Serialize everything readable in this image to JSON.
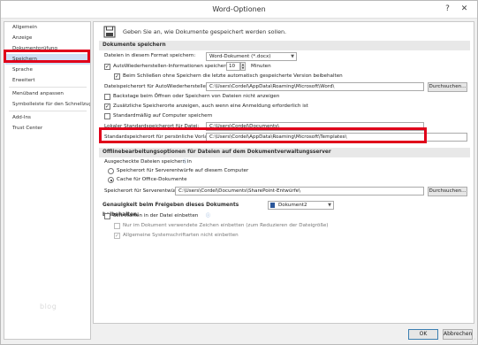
{
  "window": {
    "title": "Word-Optionen",
    "help": "?",
    "close": "✕"
  },
  "sidebar": {
    "items": [
      {
        "label": "Allgemein"
      },
      {
        "label": "Anzeige"
      },
      {
        "label": "Dokumentprüfung"
      },
      {
        "label": "Speichern",
        "selected": true
      },
      {
        "label": "Sprache"
      },
      {
        "label": "Erweitert"
      },
      {
        "label": "Menüband anpassen"
      },
      {
        "label": "Symbolleiste für den Schnellzugriff"
      },
      {
        "label": "Add-Ins"
      },
      {
        "label": "Trust Center"
      }
    ],
    "watermark": "blog"
  },
  "content": {
    "header": "Geben Sie an, wie Dokumente gespeichert werden sollen.",
    "save_section": {
      "title": "Dokumente speichern",
      "format_label": "Dateien in diesem Format speichern:",
      "format_value": "Word-Dokument (*.docx)",
      "autorecover_label": "AutoWiederherstellen-Informationen speichern alle",
      "autorecover_minutes": "10",
      "minutes_label": "Minuten",
      "keep_last_label": "Beim Schließen ohne Speichern die letzte automatisch gespeicherte Version beibehalten",
      "autorecover_path_label": "Dateispeicherort für AutoWiederherstellen:",
      "autorecover_path": "C:\\Users\\Cordel\\AppData\\Roaming\\Microsoft\\Word\\",
      "browse_label": "Durchsuchen...",
      "backstage_label": "Backstage beim Öffnen oder Speichern von Dateien nicht anzeigen",
      "extra_places_label": "Zusätzliche Speicherorte anzeigen, auch wenn eine Anmeldung erforderlich ist",
      "default_computer_label": "Standardmäßig auf Computer speichern",
      "local_default_label": "Lokaler Standardspeicherort für Datei:",
      "local_default_path": "C:\\Users\\Cordel\\Documents\\",
      "templates_label": "Standardspeicherort für persönliche Vorlagen:",
      "templates_path": "C:\\Users\\Cordel\\AppData\\Roaming\\Microsoft\\Templates\\"
    },
    "offline_section": {
      "title": "Offlinebearbeitungsoptionen für Dateien auf dem Dokumentverwaltungsserver",
      "checked_out_label": "Ausgecheckte Dateien speichern in",
      "option_server_drafts": "Speicherort für Serverentwürfe auf diesem Computer",
      "option_office_cache": "Cache für Office-Dokumente",
      "server_drafts_label": "Speicherort für Serverentwürfe:",
      "server_drafts_path": "C:\\Users\\Cordel\\Documents\\SharePoint-Entwürfe\\",
      "browse_label": "Durchsuchen..."
    },
    "fidelity_section": {
      "title": "Genauigkeit beim Freigeben dieses Dokuments beibehalten:",
      "document_value": "Dokument2",
      "embed_fonts_label": "Schriftarten in der Datei einbetten",
      "only_used_chars_label": "Nur im Dokument verwendete Zeichen einbetten (zum Reduzieren der Dateigröße)",
      "no_system_fonts_label": "Allgemeine Systemschriftarten nicht einbetten"
    }
  },
  "footer": {
    "ok_label": "OK",
    "cancel_label": "Abbrechen"
  }
}
